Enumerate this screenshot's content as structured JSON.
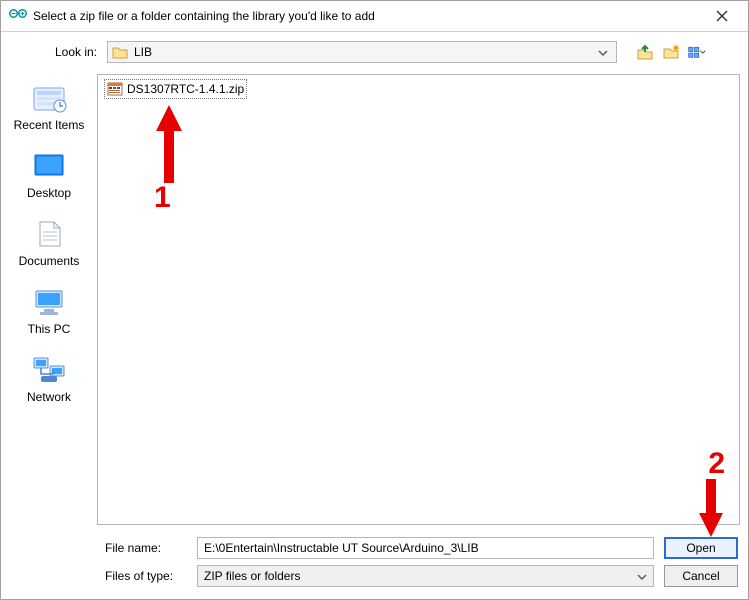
{
  "window": {
    "title": "Select a zip file or a folder containing the library you'd like to add"
  },
  "lookin": {
    "label": "Look in:",
    "value": "LIB"
  },
  "places": {
    "recent": "Recent Items",
    "desktop": "Desktop",
    "documents": "Documents",
    "thispc": "This PC",
    "network": "Network"
  },
  "file": {
    "name": "DS1307RTC-1.4.1.zip"
  },
  "annotations": {
    "n1": "1",
    "n2": "2"
  },
  "bottom": {
    "filename_label": "File name:",
    "filename_value": "E:\\0Entertain\\Instructable UT Source\\Arduino_3\\LIB",
    "filetype_label": "Files of type:",
    "filetype_value": "ZIP files or folders",
    "open": "Open",
    "cancel": "Cancel"
  }
}
